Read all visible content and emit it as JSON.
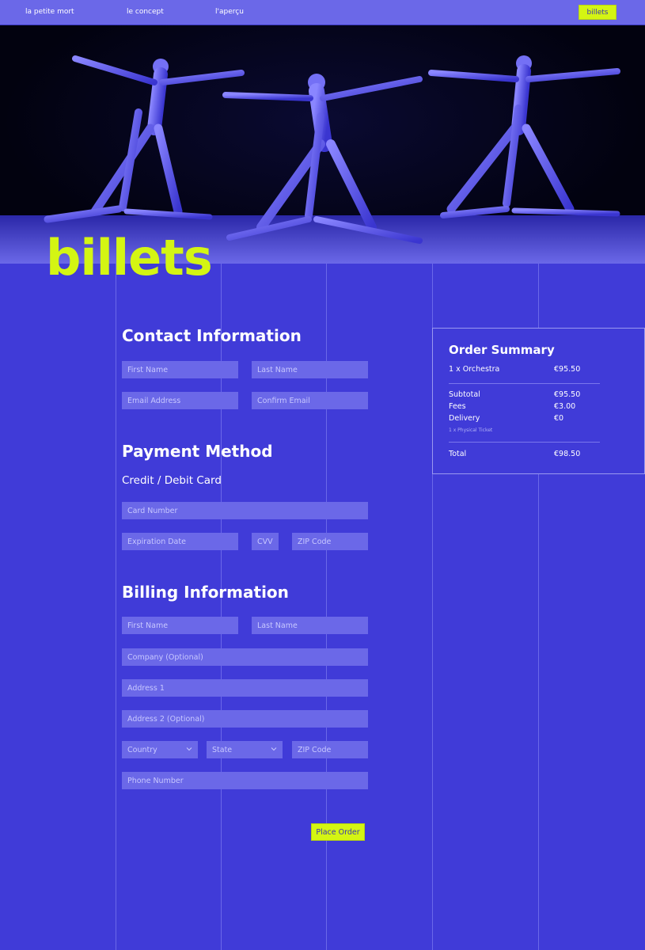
{
  "nav": {
    "links": [
      "la petite mort",
      "le concept",
      "l'aperçu"
    ],
    "cta": "billets"
  },
  "hero": {
    "image": "dancers-performance-photo"
  },
  "page_title": "billets",
  "contact": {
    "title": "Contact Information",
    "first_name": "First Name",
    "last_name": "Last Name",
    "email": "Email Address",
    "confirm_email": "Confirm Email"
  },
  "payment": {
    "title": "Payment Method",
    "method": "Credit / Debit Card",
    "card_number": "Card Number",
    "expiration": "Expiration Date",
    "cvv": "CVV",
    "zip": "ZIP Code"
  },
  "billing": {
    "title": "Billing Information",
    "first_name": "First Name",
    "last_name": "Last Name",
    "company": "Company (Optional)",
    "address1": "Address 1",
    "address2": "Address 2 (Optional)",
    "country": "Country",
    "state": "State",
    "zip": "ZIP Code",
    "phone": "Phone Number"
  },
  "summary": {
    "title": "Order Summary",
    "item_label": "1 x Orchestra",
    "item_value": "€95.50",
    "subtotal_label": "Subtotal",
    "subtotal_value": "€95.50",
    "fees_label": "Fees",
    "fees_value": "€3.00",
    "delivery_label": "Delivery",
    "delivery_value": "€0",
    "delivery_note": "1 x Physical Ticket",
    "total_label": "Total",
    "total_value": "€98.50"
  },
  "place_order": "Place Order",
  "colors": {
    "background": "#403bd8",
    "accent": "#d4f513",
    "field": "#6b68e8"
  }
}
